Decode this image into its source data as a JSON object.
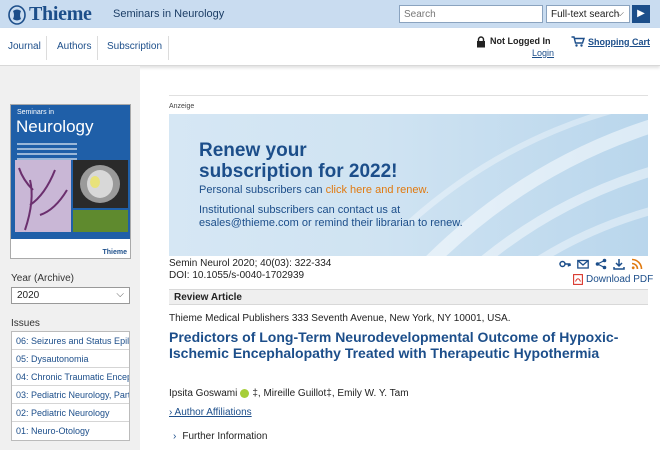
{
  "header": {
    "brand": "Thieme",
    "journal": "Seminars in Neurology",
    "search_placeholder": "Search",
    "search_mode": "Full-text search"
  },
  "nav": {
    "items": [
      "Journal",
      "Authors",
      "Subscription"
    ],
    "login_status": "Not Logged In",
    "login_link": "Login",
    "cart_link": "Shopping Cart"
  },
  "sidebar": {
    "cover_small": "Seminars in",
    "cover_title": "Neurology",
    "cover_brand": "Thieme",
    "year_label": "Year (Archive)",
    "year_value": "2020",
    "issues_label": "Issues",
    "issues": [
      "06: Seizures and Status Epile",
      "05: Dysautonomia",
      "04: Chronic Traumatic Encep",
      "03: Pediatric Neurology, Part",
      "02: Pediatric Neurology",
      "01: Neuro-Otology"
    ]
  },
  "ad": {
    "label": "Anzeige",
    "heading_line1": "Renew your",
    "heading_line2": "subscription for 2022!",
    "line1_prefix": "Personal subscribers can ",
    "line1_link": "click here and renew.",
    "line2a": "Institutional subscribers can contact us at",
    "line2b": "esales@thieme.com or remind their librarian to renew."
  },
  "article": {
    "citation": "Semin Neurol 2020; 40(03): 322-334",
    "doi": "DOI: 10.1055/s-0040-1702939",
    "download_pdf": "Download PDF",
    "type": "Review Article",
    "publisher": "Thieme Medical Publishers 333 Seventh Avenue, New York, NY 10001, USA.",
    "title": "Predictors of Long-Term Neurodevelopmental Outcome of Hypoxic-Ischemic Encephalopathy Treated with Therapeutic Hypothermia",
    "author1": "Ipsita Goswami",
    "author1_marks": "‡",
    "author2": ", Mireille Guillot‡",
    "author3": ", Emily W. Y. Tam",
    "affiliations": "› Author Affiliations",
    "further_info": "Further Information"
  }
}
